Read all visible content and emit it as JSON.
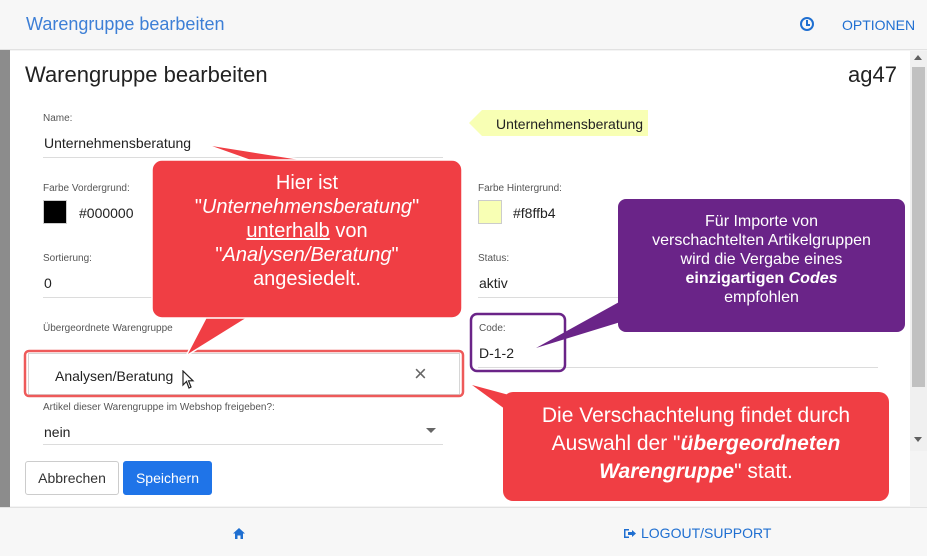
{
  "header": {
    "app_title": "Warengruppe bearbeiten",
    "history_icon": "clock-icon",
    "options_label": "OPTIONEN"
  },
  "form": {
    "title": "Warengruppe bearbeiten",
    "code_id": "ag47",
    "name_label": "Name:",
    "name_value": "Unternehmensberatung",
    "preview_label": "Unternehmensberatung",
    "fg_label": "Farbe Vordergrund:",
    "fg_value": "#000000",
    "fg_color": "#000000",
    "bg_label": "Farbe Hintergrund:",
    "bg_value": "#f8ffb4",
    "bg_color": "#f8ffb4",
    "sort_label": "Sortierung:",
    "sort_value": "0",
    "status_label": "Status:",
    "status_value": "aktiv",
    "parent_label": "Übergeordnete Warengruppe",
    "parent_value": "Analysen/Beratung",
    "code_label": "Code:",
    "code_value": "D-1-2",
    "webshop_label": "Artikel dieser Warengruppe im Webshop freigeben?:",
    "webshop_value": "nein",
    "cancel_label": "Abbrechen",
    "save_label": "Speichern"
  },
  "footer": {
    "home_icon": "home-icon",
    "logout_label": "LOGOUT/SUPPORT"
  },
  "annotations": {
    "callout1": {
      "line1": "Hier ist",
      "line2_open": "\"",
      "line2_em": "Unternehmensberatung",
      "line2_close": "\"",
      "line3_ul": "unterhalb",
      "line3_rest": " von",
      "line4_open": "\"",
      "line4_em": "Analysen/Beratung",
      "line4_close": "\"",
      "line5": "angesiedelt."
    },
    "callout2": {
      "line1": "Für Importe von",
      "line2": "verschachtelten Artikelgruppen",
      "line3": "wird die Vergabe eines",
      "line4_b": "einzigartigen ",
      "line4_bi": "Codes",
      "line5": "empfohlen"
    },
    "callout3": {
      "line1": "Die Verschachtelung findet durch",
      "line2_pre": "Auswahl der \"",
      "line2_bi": "übergeordneten",
      "line3_bi": "Warengruppe",
      "line3_rest": "\" statt."
    },
    "colors": {
      "red_callout": "#f03e44",
      "purple_callout": "#6a2488",
      "highlight_red": "#ee5a5a",
      "highlight_purple": "#6a2488"
    }
  }
}
